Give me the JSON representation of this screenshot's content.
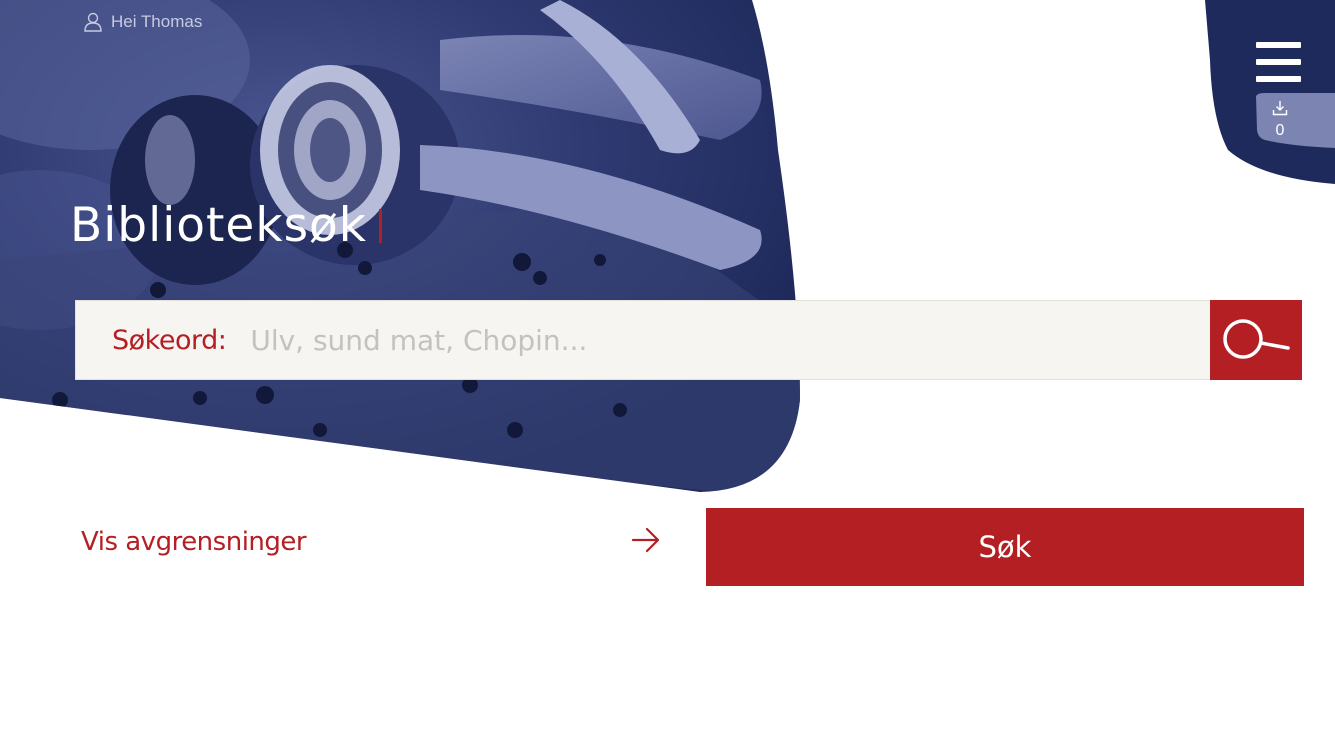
{
  "header": {
    "greeting": "Hei Thomas",
    "user_icon": "user-icon",
    "menu_icon": "hamburger-menu-icon",
    "download_icon": "download-icon",
    "download_count": "0"
  },
  "hero": {
    "title": "Biblioteksøk"
  },
  "search": {
    "label": "Søkeord:",
    "placeholder": "Ulv, sund mat, Chopin...",
    "value": "",
    "button_icon": "search-icon"
  },
  "filters": {
    "label": "Vis avgrensninger",
    "icon": "arrow-right-icon"
  },
  "submit": {
    "label": "Søk"
  },
  "colors": {
    "brand_red": "#b41f24",
    "navy": "#1f2a5c",
    "search_bg": "#f6f5f2",
    "placeholder": "#c4c2bd"
  }
}
